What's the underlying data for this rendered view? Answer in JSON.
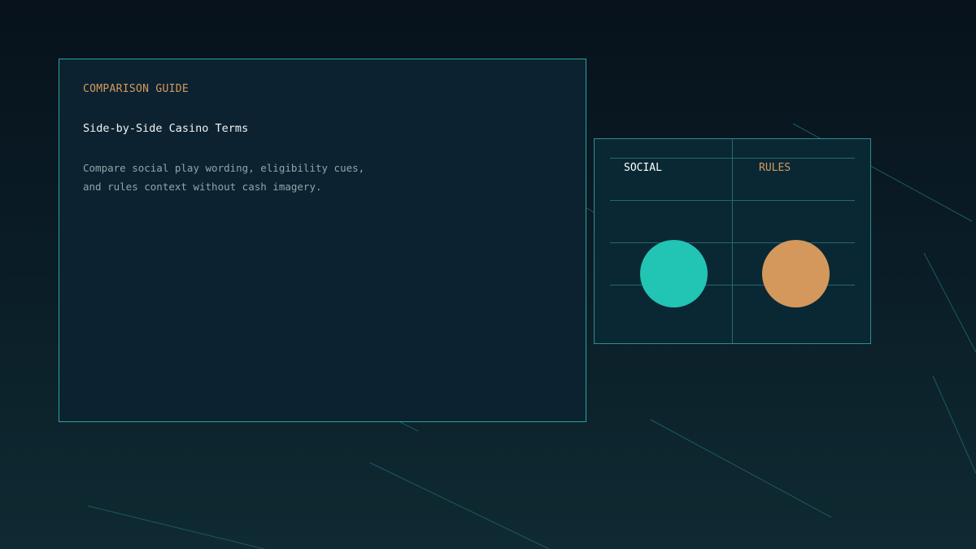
{
  "guide": {
    "eyebrow": "COMPARISON GUIDE",
    "title": "Side-by-Side Casino Terms",
    "description_lines": [
      "Compare social play wording, eligibility cues,",
      "and rules context without cash imagery."
    ]
  },
  "comparison": {
    "columns": [
      {
        "label": "SOCIAL",
        "color": "#22c4b4"
      },
      {
        "label": "RULES",
        "color": "#d4985d"
      }
    ]
  },
  "theme": {
    "background": "#07121b",
    "card_border": "#2aa59a",
    "accent_orange": "#d59a5d",
    "accent_teal": "#22c4b4"
  }
}
